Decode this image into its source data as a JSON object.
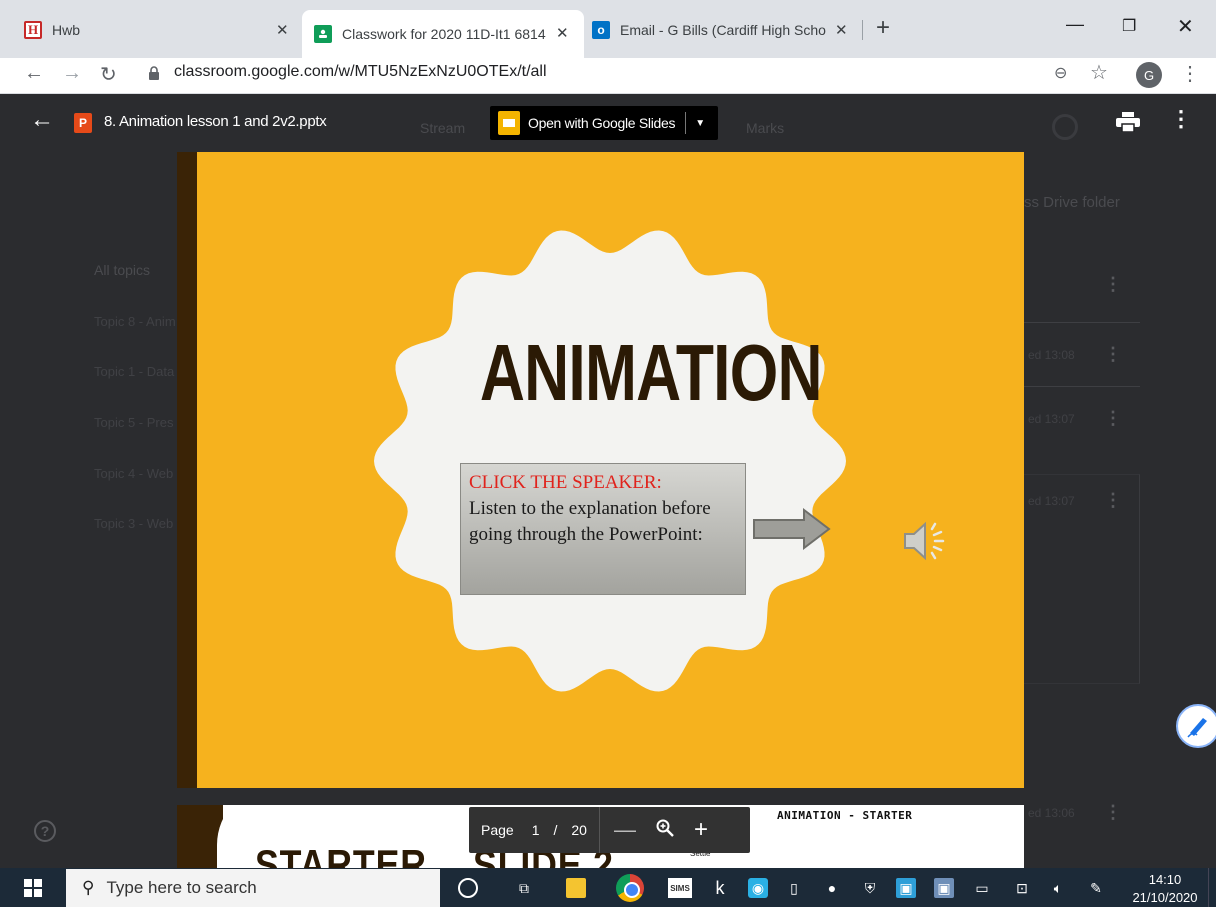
{
  "browser": {
    "tabs": [
      {
        "favicon": "H",
        "title": "Hwb",
        "active": false
      },
      {
        "favicon": "classroom-icon",
        "title": "Classwork for 2020 11D-It1 6814",
        "active": true
      },
      {
        "favicon": "outlook-icon",
        "title": "Email - G Bills (Cardiff High Scho",
        "active": false
      }
    ],
    "new_tab": "+",
    "url": "classroom.google.com/w/MTU5NzExNzU0OTEx/t/all",
    "profile_initial": "G"
  },
  "classroom_background": {
    "nav": [
      "Stream",
      "Marks"
    ],
    "drive_link": "ss Drive folder",
    "all_topics": "All topics",
    "topics": [
      "Topic 8 - Anim",
      "Topic 1 - Data",
      "Topic 5 - Pres",
      "Topic 4 - Web",
      "Topic 3 - Web"
    ],
    "posted": [
      "ed 13:08",
      "ed 13:07",
      "ed 13:07",
      "ed 13:06"
    ]
  },
  "viewer": {
    "file_type_icon": "P",
    "file_name": "8. Animation lesson 1 and 2v2.pptx",
    "open_with_label": "Open with Google Slides",
    "page_label": "Page",
    "current_page": "1",
    "separator": "/",
    "total_pages": "20",
    "zoom_out": "—",
    "zoom_in": "+"
  },
  "slide1": {
    "title": "ANIMATION",
    "info_heading": "CLICK THE SPEAKER:",
    "info_body": "Listen to the explanation before going through the PowerPoint:",
    "colors": {
      "background": "#f6b21e",
      "title": "#2b1a05",
      "heading": "#e0231c"
    }
  },
  "slide2": {
    "title_left": "STARTER",
    "title_right": "SLIDE 2",
    "heading": "ANIMATION - STARTER",
    "note": "Settle"
  },
  "taskbar": {
    "search_placeholder": "Type here to search",
    "sims_label": "SIMS",
    "k_label": "k",
    "time": "14:10",
    "date": "21/10/2020"
  }
}
